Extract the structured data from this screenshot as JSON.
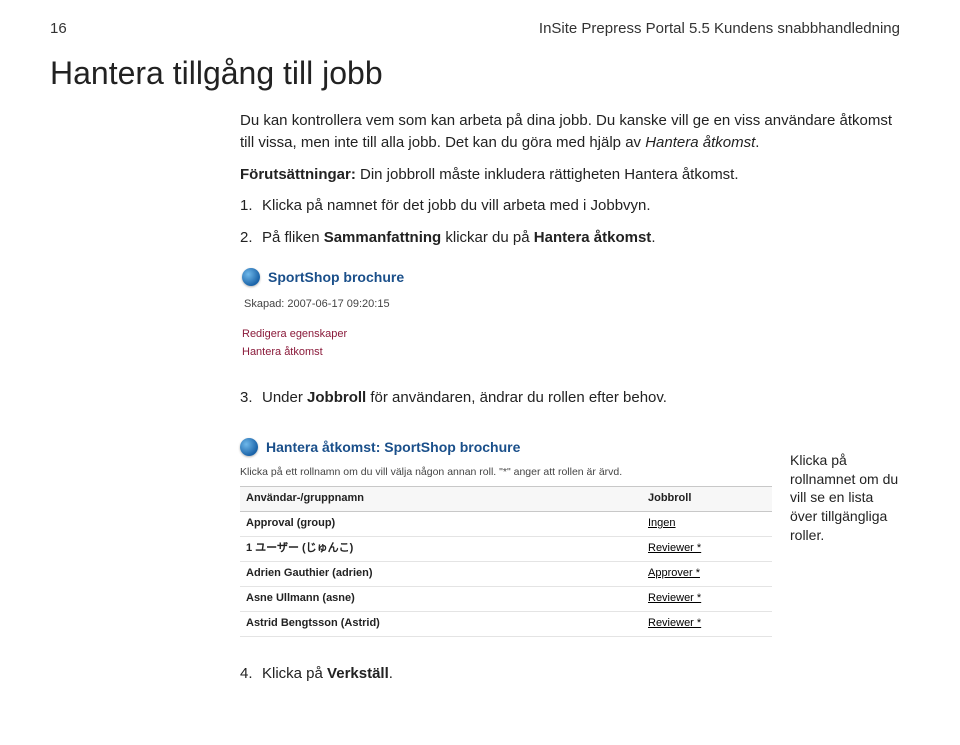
{
  "header": {
    "page_number": "16",
    "doc_title": "InSite Prepress Portal 5.5 Kundens snabbhandledning"
  },
  "title": "Hantera tillgång till jobb",
  "intro": {
    "p1a": "Du kan kontrollera vem som kan arbeta på dina jobb. Du kanske vill ge en viss användare åtkomst till vissa, men inte till alla jobb. Det kan du göra med hjälp av ",
    "p1b": "Hantera åtkomst",
    "p1c": "."
  },
  "prereq": {
    "label": "Förutsättningar:",
    "text": " Din jobbroll måste inkludera rättigheten Hantera åtkomst."
  },
  "steps": {
    "s1": {
      "num": "1.",
      "text": "Klicka på namnet för det jobb du vill arbeta med i Jobbvyn."
    },
    "s2": {
      "num": "2.",
      "a": "På fliken ",
      "b": "Sammanfattning",
      "c": " klickar du på ",
      "d": "Hantera åtkomst",
      "e": "."
    },
    "s3": {
      "num": "3.",
      "a": "Under ",
      "b": "Jobbroll",
      "c": " för användaren, ändrar du rollen efter behov."
    },
    "s4": {
      "num": "4.",
      "a": "Klicka på ",
      "b": "Verkställ",
      "c": "."
    }
  },
  "ss1": {
    "title": "SportShop brochure",
    "created": "Skapad: 2007-06-17 09:20:15",
    "link1": "Redigera egenskaper",
    "link2": "Hantera åtkomst"
  },
  "ss2": {
    "title": "Hantera åtkomst: SportShop brochure",
    "hint": "Klicka på ett rollnamn om du vill välja någon annan roll. \"*\" anger att rollen är ärvd.",
    "col1": "Användar-/gruppnamn",
    "col2": "Jobbroll",
    "rows": [
      {
        "name": "Approval (group)",
        "role": "Ingen"
      },
      {
        "name": "1 ユーザー (じゅんこ)",
        "role": "Reviewer *"
      },
      {
        "name": "Adrien Gauthier (adrien)",
        "role": "Approver *"
      },
      {
        "name": "Asne Ullmann (asne)",
        "role": "Reviewer *"
      },
      {
        "name": "Astrid Bengtsson (Astrid)",
        "role": "Reviewer *"
      }
    ]
  },
  "note": "Klicka på rollnamnet om du vill se en lista över tillgängliga roller."
}
